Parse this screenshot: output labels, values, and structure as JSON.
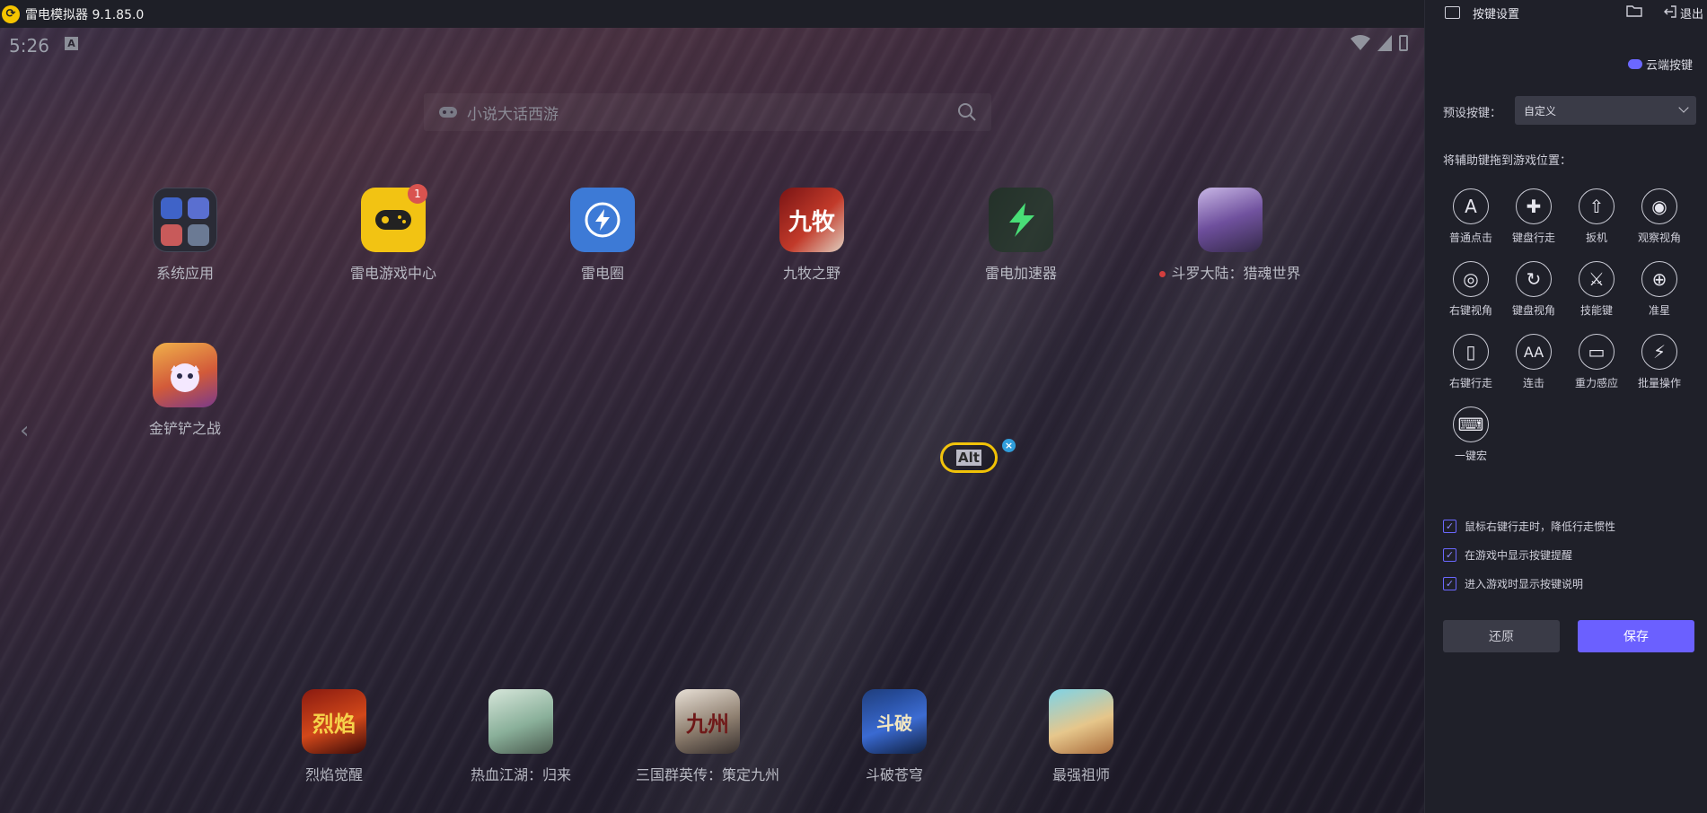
{
  "titlebar": {
    "title": "雷电模拟器 9.1.85.0",
    "logo_char": "⊕"
  },
  "status": {
    "time": "5:26",
    "indicator": "A"
  },
  "search": {
    "placeholder": "小说大话西游"
  },
  "apps": [
    {
      "label": "系统应用",
      "icon": "system-folder-icon"
    },
    {
      "label": "雷电游戏中心",
      "icon": "gamepad-icon",
      "badge": "1"
    },
    {
      "label": "雷电圈",
      "icon": "lightning-circle-icon"
    },
    {
      "label": "九牧之野",
      "icon": "jiumu-game-icon"
    },
    {
      "label": "雷电加速器",
      "icon": "accelerator-icon"
    },
    {
      "label": "斗罗大陆：猎魂世界",
      "icon": "douluo-game-icon"
    },
    {
      "label": "金铲铲之战",
      "icon": "jinchanchan-game-icon"
    }
  ],
  "dock": [
    {
      "label": "烈焰觉醒",
      "icon": "lieyan-game-icon"
    },
    {
      "label": "热血江湖：归来",
      "icon": "rexue-game-icon"
    },
    {
      "label": "三国群英传：策定九州",
      "icon": "sanguo-game-icon"
    },
    {
      "label": "斗破苍穹",
      "icon": "doupo-game-icon"
    },
    {
      "label": "最强祖师",
      "icon": "zuqiang-game-icon"
    }
  ],
  "key_overlay": {
    "label": "Alt"
  },
  "panel": {
    "title": "按键设置",
    "exit": "退出",
    "cloud_keys": "云端按键",
    "preset_label": "预设按键：",
    "preset_value": "自定义",
    "drag_hint": "将辅助键拖到游戏位置：",
    "tools": [
      {
        "label": "普通点击",
        "glyph": "A",
        "icon": "tap-icon"
      },
      {
        "label": "键盘行走",
        "glyph": "✚",
        "icon": "dpad-icon"
      },
      {
        "label": "扳机",
        "glyph": "⇧",
        "icon": "trigger-icon"
      },
      {
        "label": "观察视角",
        "glyph": "◉",
        "icon": "eye-icon"
      },
      {
        "label": "右键视角",
        "glyph": "◎",
        "icon": "right-click-view-icon"
      },
      {
        "label": "键盘视角",
        "glyph": "↻",
        "icon": "keyboard-view-icon"
      },
      {
        "label": "技能键",
        "glyph": "⚔",
        "icon": "skill-icon"
      },
      {
        "label": "准星",
        "glyph": "⊕",
        "icon": "crosshair-icon"
      },
      {
        "label": "右键行走",
        "glyph": "▯",
        "icon": "mouse-walk-icon"
      },
      {
        "label": "连击",
        "glyph": "AA",
        "icon": "combo-icon"
      },
      {
        "label": "重力感应",
        "glyph": "▭",
        "icon": "gravity-icon"
      },
      {
        "label": "批量操作",
        "glyph": "⚡",
        "icon": "batch-icon"
      },
      {
        "label": "一键宏",
        "glyph": "⌨",
        "icon": "macro-icon"
      }
    ],
    "options": [
      {
        "label": "鼠标右键行走时，降低行走惯性",
        "checked": true
      },
      {
        "label": "在游戏中显示按键提醒",
        "checked": true
      },
      {
        "label": "进入游戏时显示按键说明",
        "checked": true
      }
    ],
    "restore": "还原",
    "save": "保存"
  },
  "colors": {
    "accent": "#6b60ff",
    "overlay_ring": "#f0c000",
    "badge": "#d9534f"
  }
}
